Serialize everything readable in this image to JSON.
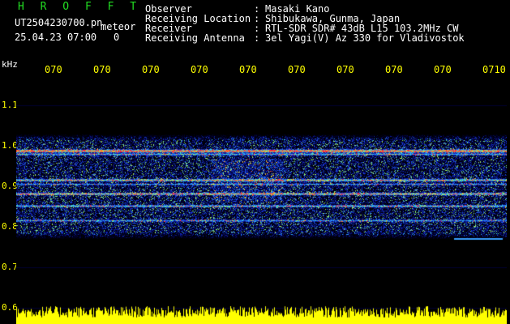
{
  "header": {
    "brand": "H R O F F T",
    "file_name": "UT2504230700.pn",
    "tag": "meteor",
    "datetime": "25.04.23 07:00",
    "counter": "0",
    "info": [
      {
        "key": "Observer",
        "value": "Masaki Kano"
      },
      {
        "key": "Receiving Location",
        "value": "Shibukawa, Gunma, Japan"
      },
      {
        "key": "Receiver",
        "value": "RTL-SDR SDR# 43dB L15 103.2MHz CW"
      },
      {
        "key": "Receiving Antenna",
        "value": "3el Yagi(V) Az 330 for Vladivostok"
      }
    ]
  },
  "axis": {
    "unit": "kHz",
    "y_ticks": [
      {
        "label": "1.1",
        "value": 1.1
      },
      {
        "label": "1.0",
        "value": 1.0
      },
      {
        "label": "0.9",
        "value": 0.9
      },
      {
        "label": "0.8",
        "value": 0.8
      },
      {
        "label": "0.7",
        "value": 0.7
      },
      {
        "label": "0.6",
        "value": 0.6
      }
    ],
    "x_ticks": [
      "070",
      "070",
      "070",
      "070",
      "070",
      "070",
      "070",
      "070",
      "070",
      "0710"
    ]
  },
  "colors": {
    "text": "#ffffff",
    "accent": "#ffff00",
    "brand": "#22dd22",
    "background": "#000000"
  }
}
